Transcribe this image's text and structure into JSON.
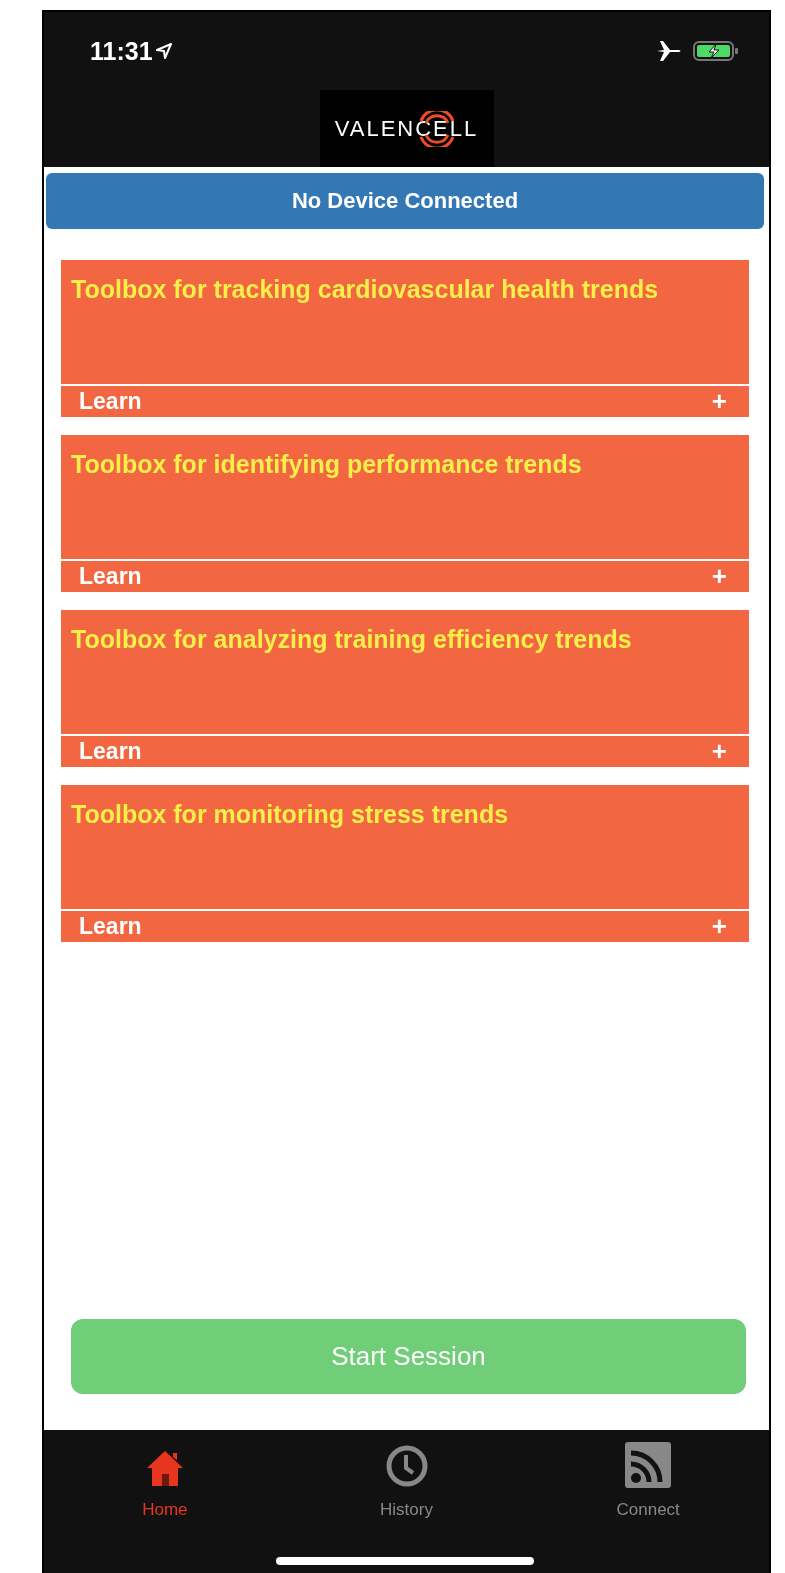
{
  "status_bar": {
    "time": "11:31"
  },
  "header": {
    "logo": "VALENCELL"
  },
  "banner": {
    "text": "No Device Connected"
  },
  "toolboxes": [
    {
      "title": "Toolbox for tracking cardiovascular health trends",
      "action": "Learn",
      "expander": "+"
    },
    {
      "title": "Toolbox for identifying performance trends",
      "action": "Learn",
      "expander": "+"
    },
    {
      "title": "Toolbox for analyzing training efficiency trends",
      "action": "Learn",
      "expander": "+"
    },
    {
      "title": "Toolbox for monitoring stress trends",
      "action": "Learn",
      "expander": "+"
    }
  ],
  "primary_button": {
    "label": "Start Session"
  },
  "tab_bar": [
    {
      "kind": "home",
      "label": "Home",
      "selected": true
    },
    {
      "kind": "history",
      "label": "History",
      "selected": false
    },
    {
      "kind": "connect",
      "label": "Connect",
      "selected": false
    }
  ]
}
